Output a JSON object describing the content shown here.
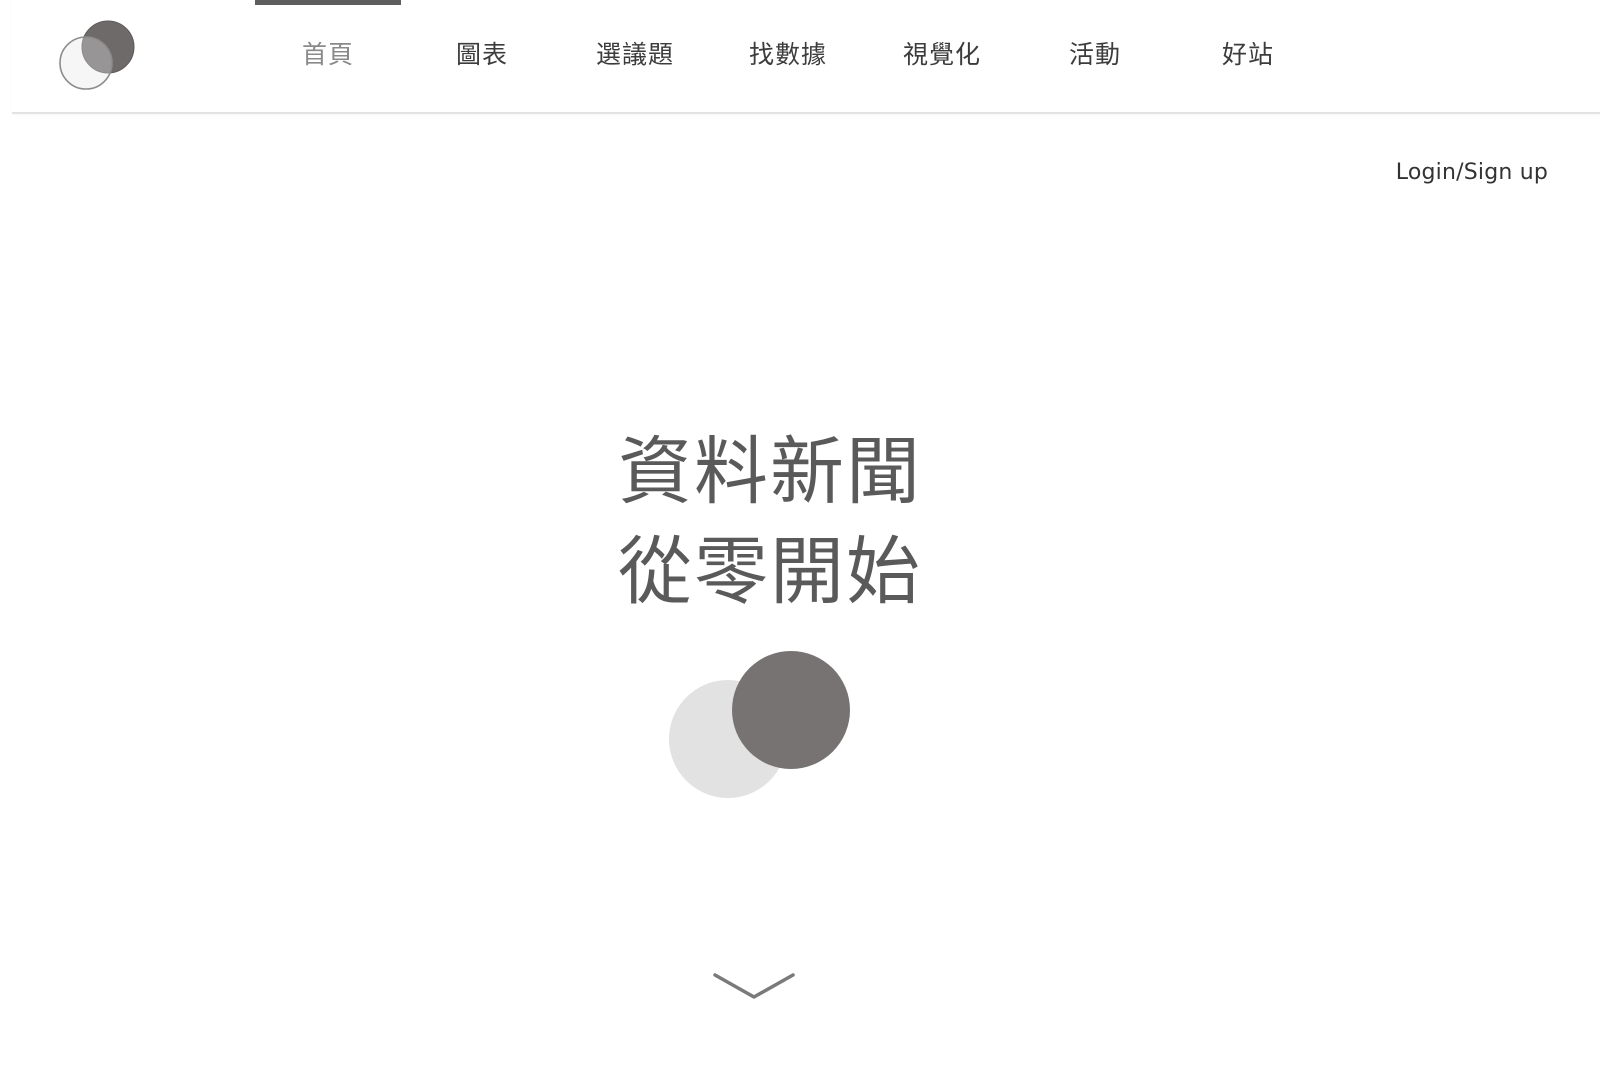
{
  "nav": {
    "items": [
      {
        "label": "首頁",
        "active": true
      },
      {
        "label": "圖表",
        "active": false
      },
      {
        "label": "選議題",
        "active": false
      },
      {
        "label": "找數據",
        "active": false
      },
      {
        "label": "視覺化",
        "active": false
      },
      {
        "label": "活動",
        "active": false
      },
      {
        "label": "好站",
        "active": false
      }
    ]
  },
  "header": {
    "login_label": "Login/Sign up"
  },
  "hero": {
    "line1": "資料新聞",
    "line2": "從零開始"
  },
  "icons": {
    "logo": "two-overlapping-circles-logo",
    "hero_graphic": "two-overlapping-circles",
    "scroll": "chevron-down-icon"
  },
  "colors": {
    "dark_circle": "#787373",
    "light_circle": "#e2e2e2",
    "active_nav": "#8a8a8a",
    "active_bar": "#5e5e5e",
    "text": "#3c3c3c"
  }
}
